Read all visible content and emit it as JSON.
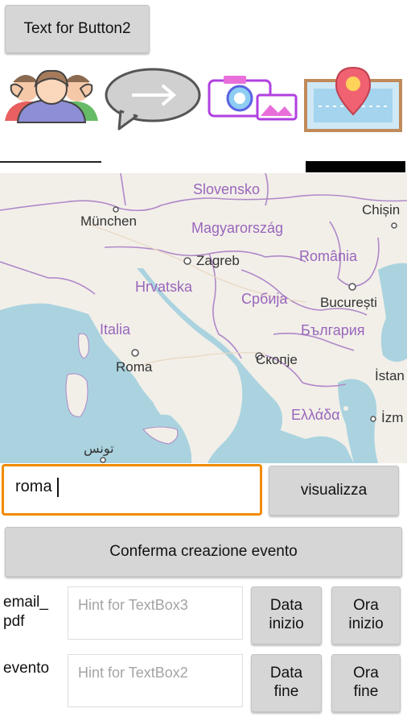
{
  "top_button": {
    "label": "Text for Button2"
  },
  "icons": [
    "users-icon",
    "forward-chat-icon",
    "camera-photo-icon",
    "map-pin-icon"
  ],
  "map": {
    "labels": {
      "slovensko": "Slovensko",
      "munchen": "München",
      "chisinau": "Chișin",
      "magyar": "Magyarország",
      "zagreb": "Zagreb",
      "romania": "România",
      "hrvatska": "Hrvatska",
      "srbija": "Србија",
      "bucuresti": "București",
      "italia": "Italia",
      "bulgaria": "България",
      "roma": "Roma",
      "skopje": "Скопје",
      "istanbul": "İstan",
      "ellada": "Ελλάδα",
      "izmir": "İzm",
      "tunis": "تونس"
    }
  },
  "search": {
    "value": "roma",
    "button": "visualizza"
  },
  "confirm_button": {
    "label": "Conferma creazione evento"
  },
  "email_row": {
    "label": "email_\npdf",
    "hint": "Hint for TextBox3",
    "date_button": "Data\ninizio",
    "time_button": "Ora\ninizio"
  },
  "event_row": {
    "label": "evento",
    "hint": "Hint for TextBox2",
    "date_button": "Data\nfine",
    "time_button": "Ora\nfine"
  },
  "colors": {
    "accent": "#f08a00",
    "button_bg": "#d6d6d6",
    "sea": "#aad3df",
    "land": "#f2efe9",
    "border_purple": "#b088c8"
  }
}
